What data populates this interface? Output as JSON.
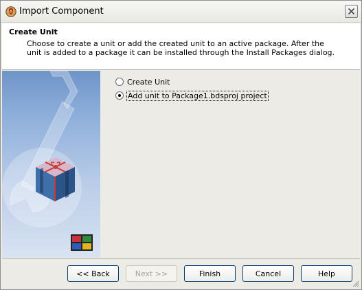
{
  "window": {
    "title": "Import Component"
  },
  "header": {
    "title": "Create Unit",
    "description": "Choose to create a unit or add the created unit to an active package. After the unit is added to a package it can be installed through the Install Packages dialog."
  },
  "options": [
    {
      "label": "Create Unit",
      "checked": false
    },
    {
      "label": "Add unit to Package1.bdsproj project",
      "checked": true
    }
  ],
  "buttons": {
    "back": "<< Back",
    "next": "Next >>",
    "finish": "Finish",
    "cancel": "Cancel",
    "help": "Help"
  },
  "colors": {
    "accent": "#003c74",
    "panel": "#ecebe6",
    "banner": "#6f94c8"
  }
}
